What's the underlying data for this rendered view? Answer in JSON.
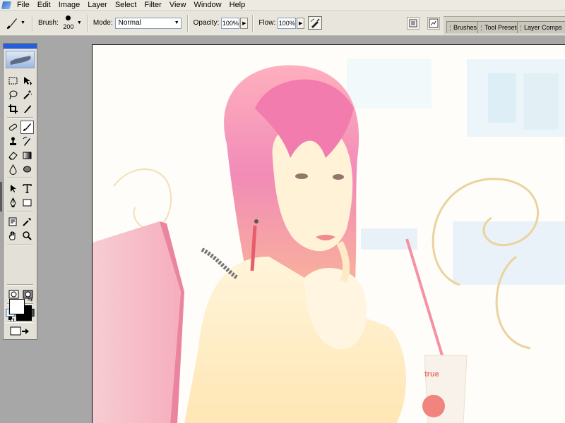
{
  "menubar": {
    "app_icon": "photoshop-feather-icon",
    "items": [
      "File",
      "Edit",
      "Image",
      "Layer",
      "Select",
      "Filter",
      "View",
      "Window",
      "Help"
    ]
  },
  "options_bar": {
    "tool_preset_icon": "brush-icon",
    "brush_label": "Brush:",
    "brush_size": "200",
    "mode_label": "Mode:",
    "mode_value": "Normal",
    "opacity_label": "Opacity:",
    "opacity_value": "100%",
    "flow_label": "Flow:",
    "flow_value": "100%",
    "airbrush_icon": "airbrush-icon",
    "file_browser_icon": "file-browser-icon",
    "image_window_icon": "document-window-icon"
  },
  "palette_well": {
    "tabs": [
      "Brushes",
      "Tool Presets",
      "Layer Comps"
    ]
  },
  "toolbox": {
    "active_tool": "brush-tool",
    "foreground_color": "#ffffff",
    "background_color": "#000000"
  },
  "document": {
    "description_colors": {
      "background": "#fffdf6",
      "hair": "#f07da8",
      "chair": "#f4b0be",
      "skin": "#ffe7b0"
    }
  }
}
